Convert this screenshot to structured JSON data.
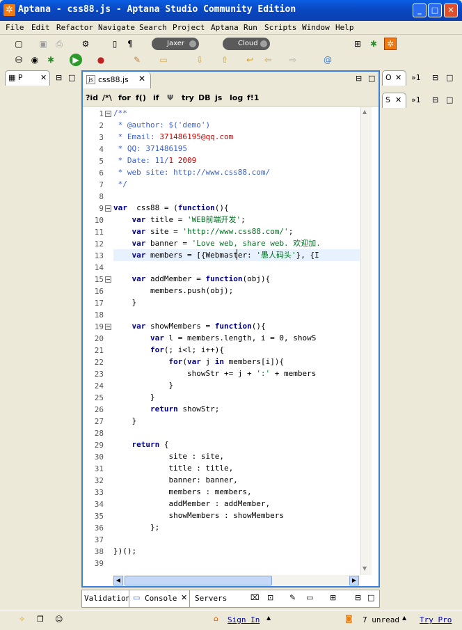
{
  "window": {
    "title": "Aptana - css88.js - Aptana Studio Community Edition",
    "min": "_",
    "max": "□",
    "close": "✕"
  },
  "menu": [
    "File",
    "Edit",
    "Refactor",
    "Navigate",
    "Search",
    "Project",
    "Aptana",
    "Run",
    "Scripts",
    "Window",
    "Help"
  ],
  "toolbar": {
    "jaxer_label": "Jaxer",
    "cloud_label": "Cloud"
  },
  "left_panel": {
    "tab": "P",
    "min": "⊟",
    "max": "□"
  },
  "right_panel": {
    "tab1": "O",
    "tab1b": "»1",
    "tab2": "S",
    "tab2b": "»1"
  },
  "editor": {
    "tab_label": "css88.js",
    "toolbar": [
      "?id",
      "/*\\",
      "for",
      "f()",
      "if",
      "try",
      "DB",
      "js",
      "log",
      "f!1"
    ],
    "line_numbers": [
      "1",
      "2",
      "3",
      "4",
      "5",
      "6",
      "7",
      "8",
      "9",
      "10",
      "11",
      "12",
      "13",
      "14",
      "15",
      "16",
      "17",
      "18",
      "19",
      "20",
      "21",
      "22",
      "23",
      "24",
      "25",
      "26",
      "27",
      "28",
      "29",
      "30",
      "31",
      "32",
      "33",
      "34",
      "35",
      "36",
      "37",
      "38",
      "39"
    ]
  },
  "code": [
    [
      [
        "c",
        "/**"
      ]
    ],
    [
      [
        "c",
        " * @author: $('demo')"
      ]
    ],
    [
      [
        "c",
        " * Email: "
      ],
      [
        "r",
        "371486195@qq.com"
      ]
    ],
    [
      [
        "c",
        " * QQ: 371486195"
      ]
    ],
    [
      [
        "c",
        " * Date: 11/"
      ],
      [
        "r",
        "1 2009"
      ]
    ],
    [
      [
        "c",
        " * web site: http://www.css88.com/"
      ]
    ],
    [
      [
        "c",
        " */"
      ]
    ],
    [],
    [
      [
        "k",
        "var"
      ],
      [
        "",
        "  css88 = ("
      ],
      [
        "k",
        "function"
      ],
      [
        "",
        "(){"
      ]
    ],
    [
      [
        "",
        "    "
      ],
      [
        "k",
        "var"
      ],
      [
        "",
        " title = "
      ],
      [
        "s",
        "'WEB前端开发'"
      ],
      [
        "",
        ";"
      ]
    ],
    [
      [
        "",
        "    "
      ],
      [
        "k",
        "var"
      ],
      [
        "",
        " site = "
      ],
      [
        "s",
        "'http://www.css88.com/'"
      ],
      [
        "",
        ";"
      ]
    ],
    [
      [
        "",
        "    "
      ],
      [
        "k",
        "var"
      ],
      [
        "",
        " banner = "
      ],
      [
        "s",
        "'Love web, share web. 欢迎加."
      ]
    ],
    [
      [
        "",
        "    "
      ],
      [
        "k",
        "var"
      ],
      [
        "",
        " members = [{Webmaster: "
      ],
      [
        "s",
        "'愚人码头'"
      ],
      [
        "",
        "}, {I"
      ]
    ],
    [],
    [
      [
        "",
        "    "
      ],
      [
        "k",
        "var"
      ],
      [
        "",
        " addMember = "
      ],
      [
        "k",
        "function"
      ],
      [
        "",
        "(obj){"
      ]
    ],
    [
      [
        "",
        "        members.push(obj);"
      ]
    ],
    [
      [
        "",
        "    }"
      ]
    ],
    [],
    [
      [
        "",
        "    "
      ],
      [
        "k",
        "var"
      ],
      [
        "",
        " showMembers = "
      ],
      [
        "k",
        "function"
      ],
      [
        "",
        "(){"
      ]
    ],
    [
      [
        "",
        "        "
      ],
      [
        "k",
        "var"
      ],
      [
        "",
        " l = members.length, i = 0, showS"
      ]
    ],
    [
      [
        "",
        "        "
      ],
      [
        "k",
        "for"
      ],
      [
        "",
        "(; i<l; i++){"
      ]
    ],
    [
      [
        "",
        "            "
      ],
      [
        "k",
        "for"
      ],
      [
        "",
        "("
      ],
      [
        "k",
        "var"
      ],
      [
        "",
        " j "
      ],
      [
        "k",
        "in"
      ],
      [
        "",
        " members[i]){"
      ]
    ],
    [
      [
        "",
        "                showStr += j + "
      ],
      [
        "s",
        "':'"
      ],
      [
        "",
        " + members"
      ]
    ],
    [
      [
        "",
        "            }"
      ]
    ],
    [
      [
        "",
        "        }"
      ]
    ],
    [
      [
        "",
        "        "
      ],
      [
        "k",
        "return"
      ],
      [
        "",
        " showStr;"
      ]
    ],
    [
      [
        "",
        "    }"
      ]
    ],
    [],
    [
      [
        "",
        "    "
      ],
      [
        "k",
        "return"
      ],
      [
        "",
        " {"
      ]
    ],
    [
      [
        "",
        "            site : site,"
      ]
    ],
    [
      [
        "",
        "            title : title,"
      ]
    ],
    [
      [
        "",
        "            banner: banner,"
      ]
    ],
    [
      [
        "",
        "            members : members,"
      ]
    ],
    [
      [
        "",
        "            addMember : addMember,"
      ]
    ],
    [
      [
        "",
        "            showMembers : showMembers"
      ]
    ],
    [
      [
        "",
        "        };"
      ]
    ],
    [],
    [
      [
        "",
        "})();"
      ]
    ],
    []
  ],
  "bottom_panel": {
    "tabs": [
      "Validation",
      "Console",
      "Servers"
    ]
  },
  "status": {
    "sign_in": "Sign In",
    "unread": "7 unread",
    "try_pro": "Try Pro"
  }
}
